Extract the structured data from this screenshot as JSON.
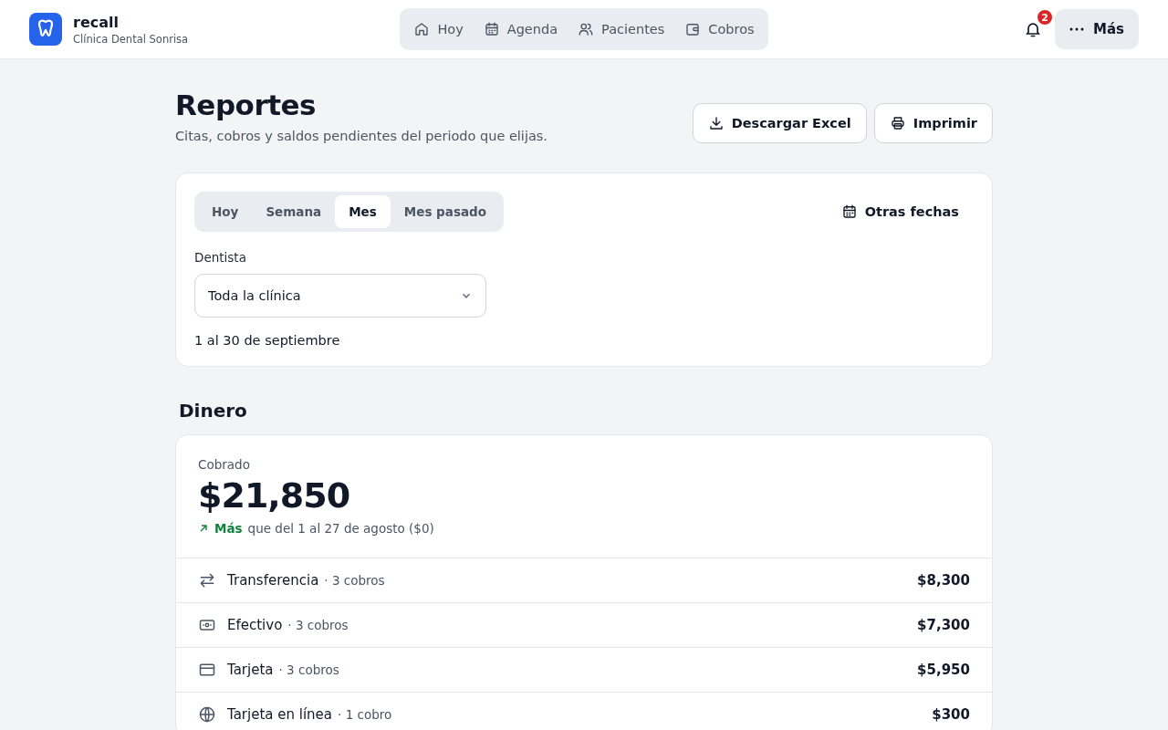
{
  "app": {
    "name": "recall",
    "clinic": "Clínica Dental Sonrisa"
  },
  "nav": [
    {
      "label": "Hoy",
      "kind": "home",
      "selected": false
    },
    {
      "label": "Agenda",
      "kind": "calendar",
      "selected": false
    },
    {
      "label": "Pacientes",
      "kind": "users",
      "selected": false
    },
    {
      "label": "Cobros",
      "kind": "wallet",
      "selected": false
    }
  ],
  "notifications": {
    "count": "2"
  },
  "more_button": "Más",
  "page": {
    "title": "Reportes",
    "subtitle": "Citas, cobros y saldos pendientes del periodo que elijas."
  },
  "actions": [
    {
      "label": "Descargar Excel",
      "kind": "download"
    },
    {
      "label": "Imprimir",
      "kind": "printer"
    }
  ],
  "filters": {
    "periods": [
      {
        "label": "Hoy",
        "selected": false
      },
      {
        "label": "Semana",
        "selected": false
      },
      {
        "label": "Mes",
        "selected": true
      },
      {
        "label": "Mes pasado",
        "selected": false
      }
    ],
    "other_dates": "Otras fechas",
    "dentist_label": "Dentista",
    "dentist_value": "Toda la clínica",
    "range": "1 al 30 de septiembre"
  },
  "money": {
    "heading": "Dinero",
    "label": "Cobrado",
    "total": "$21,850",
    "trend": {
      "word": "Más",
      "text": "que del 1 al 27 de agosto ($0)"
    },
    "methods": [
      {
        "kind": "transfer",
        "name": "Transferencia",
        "count": "· 3 cobros",
        "amount": "$8,300"
      },
      {
        "kind": "cash",
        "name": "Efectivo",
        "count": "· 3 cobros",
        "amount": "$7,300"
      },
      {
        "kind": "card",
        "name": "Tarjeta",
        "count": "· 3 cobros",
        "amount": "$5,950"
      },
      {
        "kind": "globe",
        "name": "Tarjeta en línea",
        "count": "· 1 cobro",
        "amount": "$300"
      }
    ]
  }
}
